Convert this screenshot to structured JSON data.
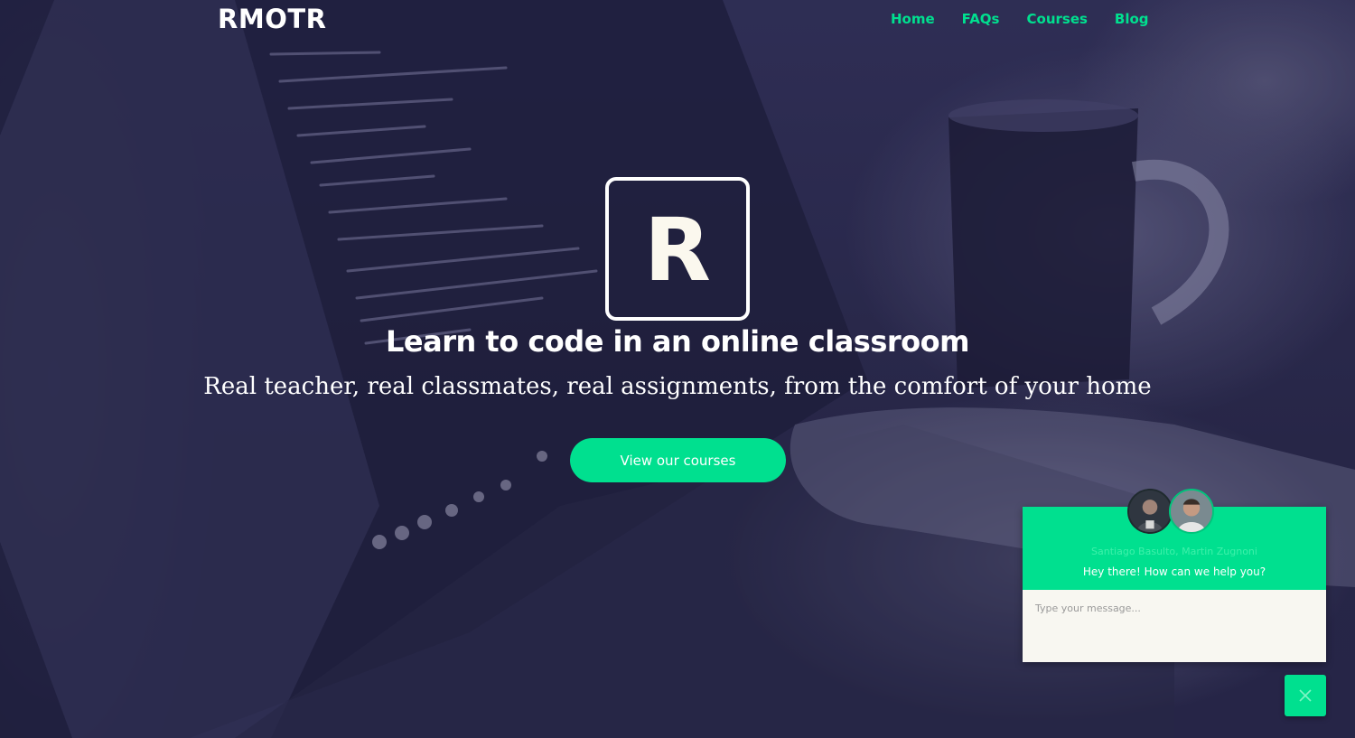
{
  "brand": {
    "name": "RMOTR"
  },
  "nav": {
    "items": [
      {
        "label": "Home"
      },
      {
        "label": "FAQs"
      },
      {
        "label": "Courses"
      },
      {
        "label": "Blog"
      }
    ]
  },
  "hero": {
    "logo_letter": "R",
    "title": "Learn to code in an online classroom",
    "subtitle": "Real teacher, real classmates, real assignments, from the comfort of your home",
    "cta_label": "View our courses"
  },
  "chat": {
    "names": "Santiago Basulto, Martin Zugnoni",
    "greeting": "Hey there! How can we help you?",
    "input_placeholder": "Type your message...",
    "avatars": [
      "avatar-santiago",
      "avatar-martin"
    ],
    "close_icon": "close-icon"
  },
  "colors": {
    "accent": "#00e08f",
    "background": "#2b2a4a",
    "text": "#ffffff"
  }
}
